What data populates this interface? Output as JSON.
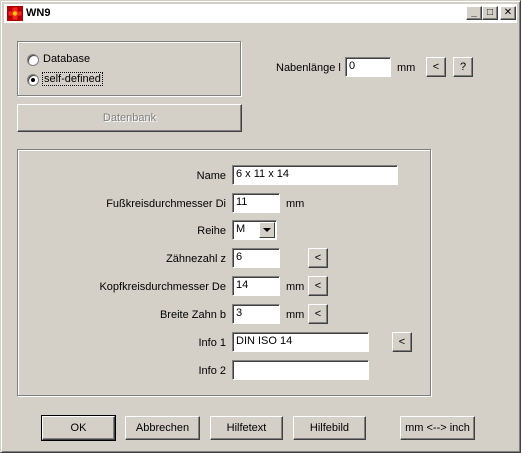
{
  "window": {
    "title": "WN9",
    "minimize": "_",
    "maximize": "□",
    "close": "✕"
  },
  "source": {
    "database_label": "Database",
    "self_defined_label": "self-defined",
    "selected": "self-defined",
    "datenbank_button": "Datenbank"
  },
  "naben": {
    "label": "Nabenlänge l",
    "value": "0",
    "unit": "mm",
    "back_button": "<",
    "help_button": "?"
  },
  "form": {
    "name": {
      "label": "Name",
      "value": "6 x 11 x 14"
    },
    "fussdurchmesser": {
      "label": "Fußkreisdurchmesser Di",
      "value": "11",
      "unit": "mm"
    },
    "reihe": {
      "label": "Reihe",
      "value": "M"
    },
    "zaehnezahl": {
      "label": "Zähnezahl z",
      "value": "6",
      "button": "<"
    },
    "kopfdurchmesser": {
      "label": "Kopfkreisdurchmesser De",
      "value": "14",
      "unit": "mm",
      "button": "<"
    },
    "breite": {
      "label": "Breite Zahn b",
      "value": "3",
      "unit": "mm",
      "button": "<"
    },
    "info1": {
      "label": "Info 1",
      "value": "DIN ISO 14",
      "button": "<"
    },
    "info2": {
      "label": "Info 2",
      "value": ""
    }
  },
  "footer": {
    "ok": "OK",
    "abbrechen": "Abbrechen",
    "hilfetext": "Hilfetext",
    "hilfebild": "Hilfebild",
    "units_toggle": "mm <--> inch"
  }
}
